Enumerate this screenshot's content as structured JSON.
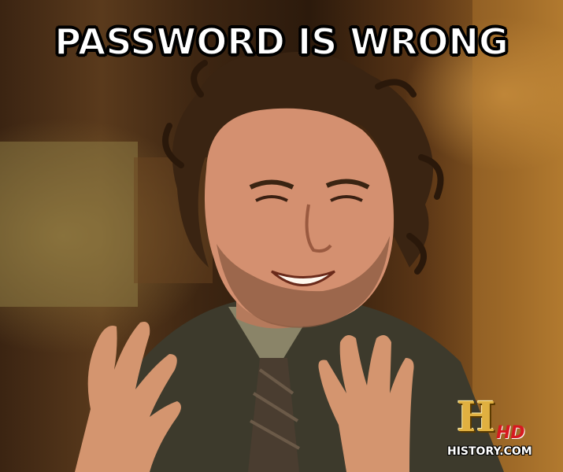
{
  "meme": {
    "caption": "PASSWORD IS WRONG"
  },
  "watermark": {
    "logo_letter": "H",
    "logo_badge": "HD",
    "site": "HISTORY.COM",
    "colors": {
      "gold": "#e0b040",
      "red": "#d71920"
    }
  },
  "scene": {
    "subject": "man-with-wild-hair-gesturing",
    "colors": {
      "background_warm": "#8a5a22",
      "suit": "#3d3a2c",
      "skin": "#d49070"
    }
  }
}
